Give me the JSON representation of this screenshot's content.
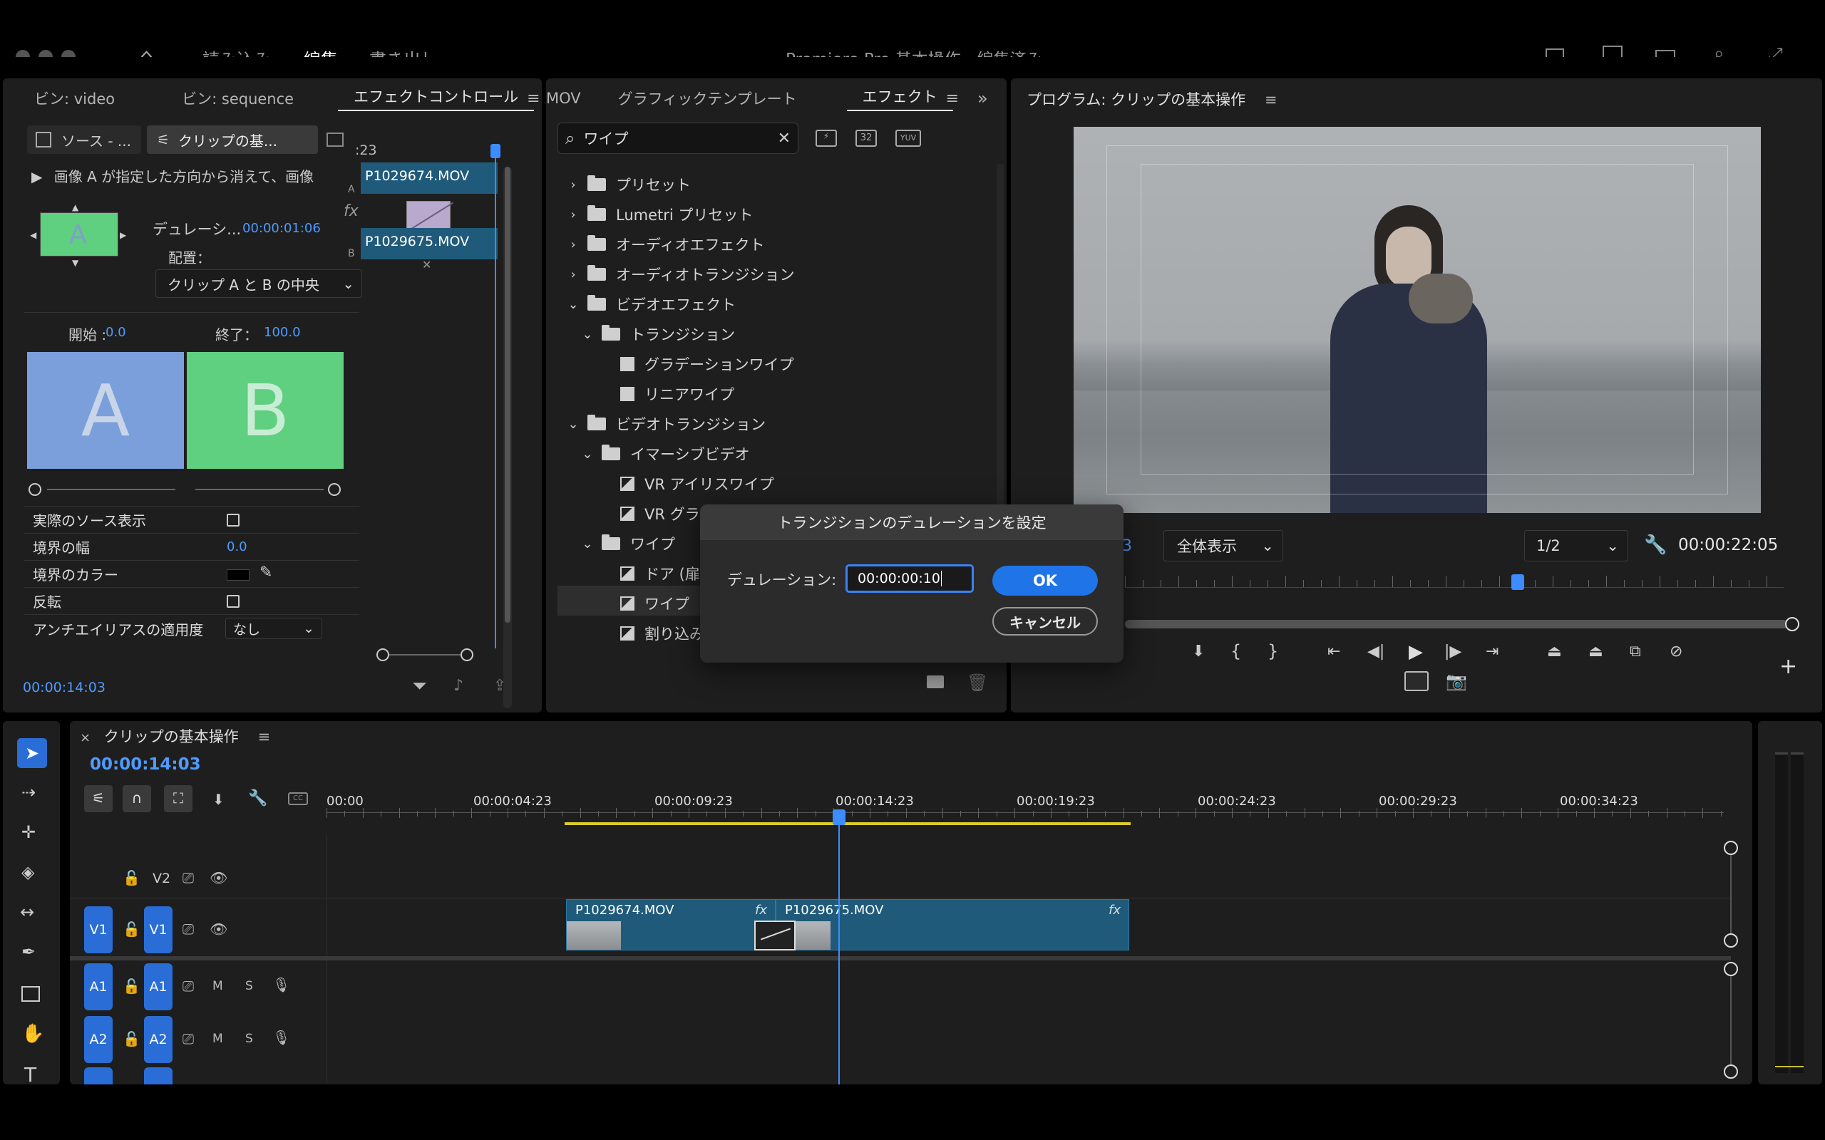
{
  "topbar": {
    "home_icon": "home-icon",
    "tabs": [
      "読み込み",
      "編集",
      "書き出し"
    ],
    "title": "Premiere Pro 基本操作 - 編集済み"
  },
  "effect_controls": {
    "tabs": [
      "ビン: video",
      "ビン: sequence",
      "エフェクトコントロール"
    ],
    "source_tab": "ソース - ...",
    "clip_tab": "クリップの基...",
    "mini_time": ":23",
    "description": "画像 A が指定した方向から消えて、画像",
    "duration_label": "デュレーシ...",
    "duration_value": "00:00:01:06",
    "alignment_label": "配置：",
    "alignment_value": "クリップ A と B の中央",
    "start_label": "開始 :",
    "start_value": "0.0",
    "end_label": "終了：",
    "end_value": "100.0",
    "preview_a": "A",
    "preview_b": "B",
    "thumb_letter": "A",
    "clip_a": "P1029674.MOV",
    "clip_b": "P1029675.MOV",
    "track_a": "A",
    "track_b": "B",
    "fx": "fx",
    "props": [
      {
        "label": "実際のソース表示",
        "type": "checkbox"
      },
      {
        "label": "境界の幅",
        "value": "0.0"
      },
      {
        "label": "境界のカラー",
        "type": "color"
      },
      {
        "label": "反転",
        "type": "checkbox"
      },
      {
        "label": "アンチエイリアスの適用度",
        "value": "なし"
      }
    ],
    "timecode": "00:00:14:03"
  },
  "effects_panel": {
    "tabs": [
      "MOV",
      "グラフィックテンプレート",
      "エフェクト"
    ],
    "search_value": "ワイプ",
    "badge_32": "32",
    "badge_yuv": "YUV",
    "tree": [
      {
        "label": "プリセット",
        "kind": "preset",
        "expand": "closed",
        "level": 0
      },
      {
        "label": "Lumetri プリセット",
        "kind": "preset",
        "expand": "closed",
        "level": 0
      },
      {
        "label": "オーディオエフェクト",
        "kind": "folder",
        "expand": "closed",
        "level": 0
      },
      {
        "label": "オーディオトランジション",
        "kind": "folder",
        "expand": "closed",
        "level": 0
      },
      {
        "label": "ビデオエフェクト",
        "kind": "folder",
        "expand": "open",
        "level": 0
      },
      {
        "label": "トランジション",
        "kind": "folder",
        "expand": "open",
        "level": 1
      },
      {
        "label": "グラデーションワイプ",
        "kind": "effect",
        "level": 2
      },
      {
        "label": "リニアワイプ",
        "kind": "effect",
        "level": 2
      },
      {
        "label": "ビデオトランジション",
        "kind": "folder",
        "expand": "open",
        "level": 0
      },
      {
        "label": "イマーシブビデオ",
        "kind": "folder",
        "expand": "open",
        "level": 1
      },
      {
        "label": "VR アイリスワイプ",
        "kind": "transition",
        "level": 2
      },
      {
        "label": "VR グラ",
        "kind": "transition",
        "level": 2
      },
      {
        "label": "ワイプ",
        "kind": "folder",
        "expand": "open",
        "level": 1
      },
      {
        "label": "ドア (扉",
        "kind": "transition",
        "level": 2
      },
      {
        "label": "ワイプ",
        "kind": "transition",
        "level": 2,
        "selected": true
      },
      {
        "label": "割り込み",
        "kind": "transition",
        "level": 2
      }
    ]
  },
  "program": {
    "title": "プログラム: クリップの基本操作",
    "left_timecode_tail": "3",
    "fit": "全体表示",
    "resolution": "1/2",
    "duration": "00:00:22:05"
  },
  "dialog": {
    "title": "トランジションのデュレーションを設定",
    "label": "デュレーション:",
    "value": "00:00:00:10",
    "ok": "OK",
    "cancel": "キャンセル"
  },
  "timeline": {
    "title": "クリップの基本操作",
    "timecode": "00:00:14:03",
    "ruler": [
      "00:00",
      "00:00:04:23",
      "00:00:09:23",
      "00:00:14:23",
      "00:00:19:23",
      "00:00:24:23",
      "00:00:29:23",
      "00:00:34:23"
    ],
    "tracks": {
      "v2": "V2",
      "v1": "V1",
      "a1": "A1",
      "a2": "A2",
      "m": "M",
      "s": "S"
    },
    "clip1": "P1029674.MOV",
    "clip2": "P1029675.MOV",
    "fx": "fx"
  },
  "colors": {
    "accent": "#2680eb",
    "clip": "#1f5a7a",
    "panel": "#1e1e1e",
    "wa": "#7b9fdb",
    "wb": "#5fcf80"
  }
}
